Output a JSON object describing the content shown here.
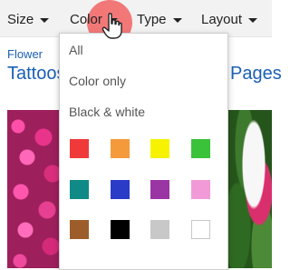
{
  "toolbar": {
    "size_label": "Size",
    "color_label": "Color",
    "type_label": "Type",
    "layout_label": "Layout"
  },
  "page": {
    "breadcrumb": "Flower",
    "headline": "Tattoos",
    "headline_right": "Pages"
  },
  "dropdown": {
    "items": [
      "All",
      "Color only",
      "Black & white"
    ],
    "swatches": [
      {
        "name": "red",
        "color": "#f03a3a"
      },
      {
        "name": "orange",
        "color": "#f49a3a"
      },
      {
        "name": "yellow",
        "color": "#f7f200"
      },
      {
        "name": "green",
        "color": "#3ac23a"
      },
      {
        "name": "teal",
        "color": "#0f8a86"
      },
      {
        "name": "blue",
        "color": "#2a3bc8"
      },
      {
        "name": "purple",
        "color": "#9a35a4"
      },
      {
        "name": "pink",
        "color": "#f29ad8"
      },
      {
        "name": "brown",
        "color": "#9c5d2a"
      },
      {
        "name": "black",
        "color": "#000000"
      },
      {
        "name": "gray",
        "color": "#c8c8c8"
      },
      {
        "name": "white",
        "color": "#ffffff"
      }
    ]
  },
  "colors": {
    "link": "#1a5fb4",
    "highlight": "#f26a6a"
  }
}
